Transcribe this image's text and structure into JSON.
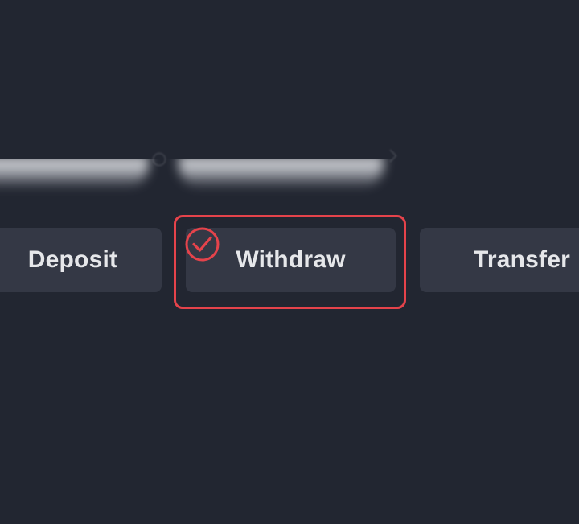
{
  "actions": {
    "deposit_label": "Deposit",
    "withdraw_label": "Withdraw",
    "transfer_label": "Transfer"
  },
  "selection": {
    "selected_action": "withdraw",
    "highlight_color": "#e5434b"
  },
  "colors": {
    "background": "#222631",
    "button_bg": "#343845",
    "button_text": "#e6e7ea"
  },
  "icons": {
    "selected_indicator": "check-circle-icon"
  }
}
